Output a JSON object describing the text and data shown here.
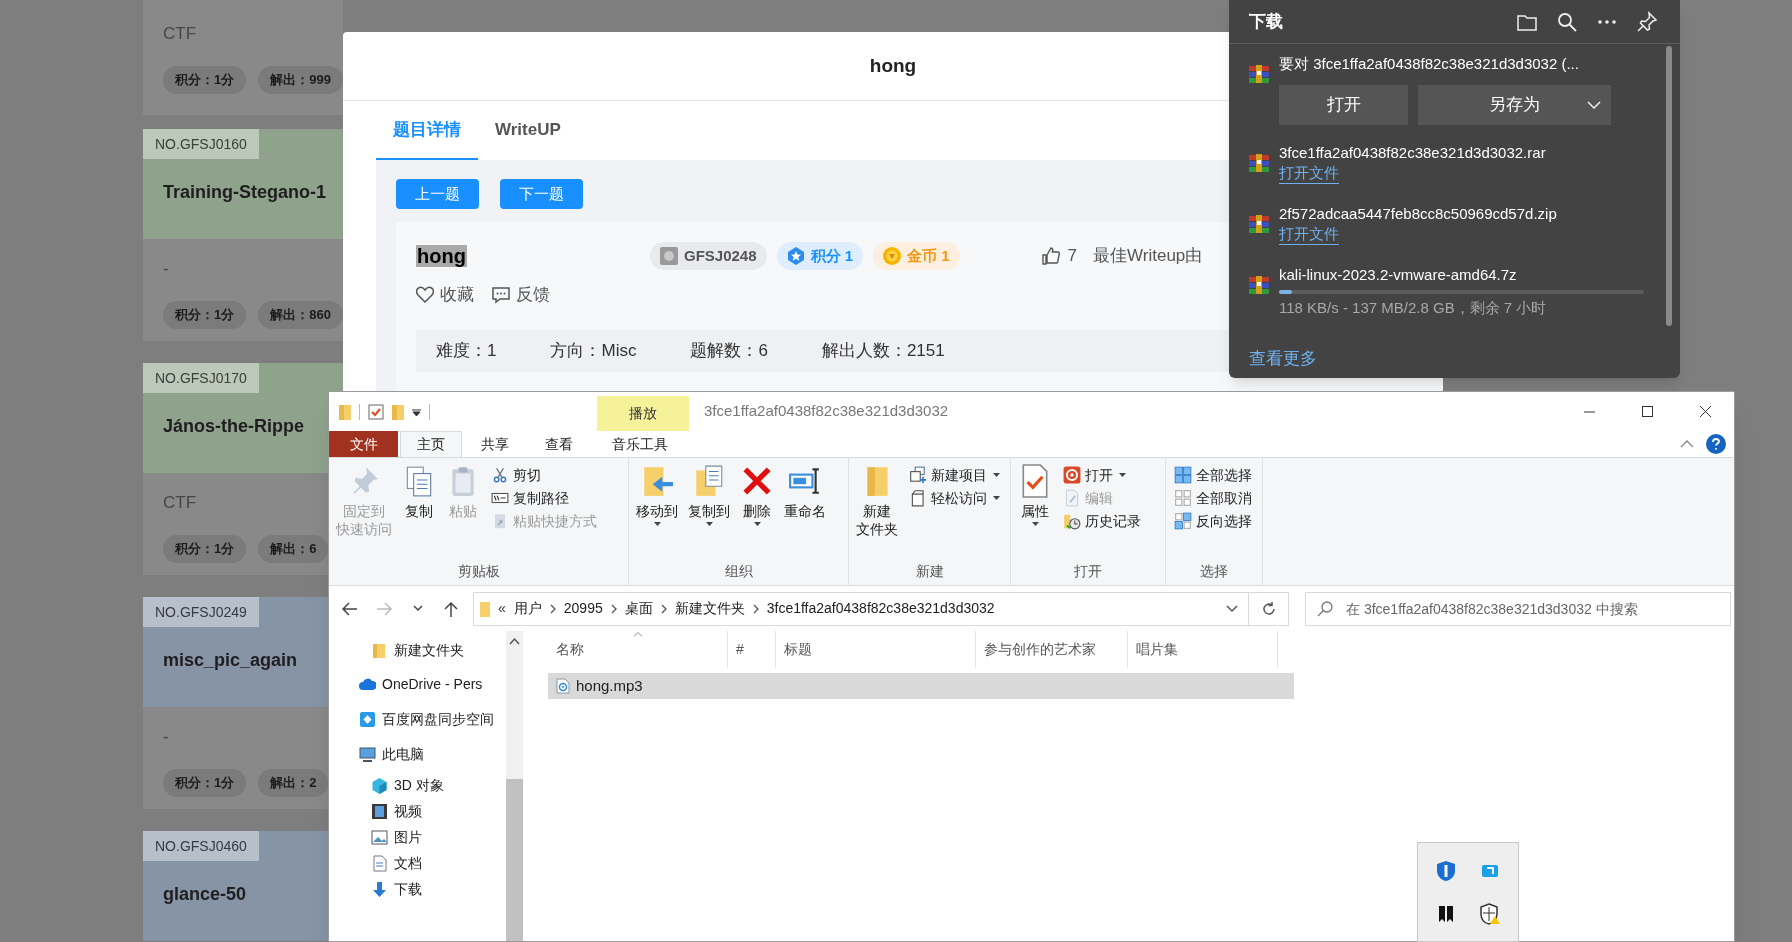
{
  "background_page": {
    "cards": [
      {
        "category": "CTF",
        "tags": [
          "积分：1分",
          "解出：999"
        ]
      },
      {
        "number": "NO.GFSJ0160",
        "color": "#8fa38c",
        "title": "Training-Stegano-1",
        "category": "-",
        "tags": [
          "积分：1分",
          "解出：860"
        ]
      },
      {
        "number": "NO.GFSJ0170",
        "color": "#8fa38c",
        "title": "János-the-Rippe",
        "category": "CTF",
        "tags": [
          "积分：1分",
          "解出：6"
        ]
      },
      {
        "number": "NO.GFSJ0249",
        "color": "#8794a6",
        "title": "misc_pic_again",
        "category": "-",
        "tags": [
          "积分：1分",
          "解出：2"
        ]
      },
      {
        "number": "NO.GFSJ0460",
        "color": "#8794a6",
        "title": "glance-50"
      }
    ]
  },
  "modal": {
    "title": "hong",
    "tabs": [
      {
        "label": "题目详情",
        "selected": true
      },
      {
        "label": "WriteUP",
        "selected": false
      }
    ],
    "nav_buttons": [
      "上一题",
      "下一题"
    ],
    "challenge": {
      "name": "hong",
      "badges": [
        {
          "kind": "id",
          "text": "GFSJ0248"
        },
        {
          "kind": "score",
          "text": "积分 1"
        },
        {
          "kind": "coin",
          "text": "金币 1"
        }
      ],
      "likes": "7",
      "best_writeup": "最佳Writeup由",
      "actions": [
        {
          "kind": "favorite",
          "label": "收藏"
        },
        {
          "kind": "feedback",
          "label": "反馈"
        }
      ],
      "stats": [
        "难度：1",
        "方向：Misc",
        "题解数：6",
        "解出人数：2151"
      ]
    }
  },
  "downloads_panel": {
    "title": "下载",
    "items": [
      {
        "kind": "prompt",
        "text": "要对 3fce1ffa2af0438f82c38e321d3d3032 (...",
        "buttons": [
          "打开",
          "另存为"
        ]
      },
      {
        "kind": "done",
        "name": "3fce1ffa2af0438f82c38e321d3d3032.rar",
        "link": "打开文件"
      },
      {
        "kind": "done",
        "name": "2f572adcaa5447feb8cc8c50969cd57d.zip",
        "link": "打开文件"
      },
      {
        "kind": "progress",
        "name": "kali-linux-2023.2-vmware-amd64.7z",
        "level": 0.035,
        "status": "118 KB/s - 137 MB/2.8 GB，剩余 7 小时"
      }
    ],
    "more_link": "查看更多"
  },
  "explorer": {
    "title": "3fce1ffa2af0438f82c38e321d3d3032",
    "context_tab": "播放",
    "ribbon_tabs": [
      {
        "label": "文件",
        "kind": "file",
        "selected": false
      },
      {
        "label": "主页",
        "kind": "tab",
        "selected": true
      },
      {
        "label": "共享",
        "kind": "tab",
        "selected": false
      },
      {
        "label": "查看",
        "kind": "tab",
        "selected": false
      },
      {
        "label": "音乐工具",
        "kind": "tab",
        "selected": false
      }
    ],
    "ribbon_groups": [
      {
        "label": "剪贴板",
        "buttons": [
          {
            "kind": "pin",
            "lines": [
              "固定到",
              "快速访问"
            ],
            "disabled": true,
            "dropdown": false
          },
          {
            "kind": "copy",
            "lines": [
              "复制"
            ],
            "disabled": false,
            "dropdown": false
          },
          {
            "kind": "paste",
            "lines": [
              "粘贴"
            ],
            "disabled": true,
            "dropdown": false
          }
        ],
        "small_buttons": [
          {
            "kind": "cut",
            "label": "剪切",
            "disabled": false,
            "dropdown": false
          },
          {
            "kind": "copy-path",
            "label": "复制路径",
            "disabled": false,
            "dropdown": false
          },
          {
            "kind": "paste-shortcut",
            "label": "粘贴快捷方式",
            "disabled": true,
            "dropdown": false
          }
        ]
      },
      {
        "label": "组织",
        "buttons": [
          {
            "kind": "move",
            "lines": [
              "移动到"
            ],
            "disabled": false,
            "dropdown": true
          },
          {
            "kind": "copy-to",
            "lines": [
              "复制到"
            ],
            "disabled": false,
            "dropdown": true
          },
          {
            "kind": "delete",
            "lines": [
              "删除"
            ],
            "disabled": false,
            "dropdown": true
          },
          {
            "kind": "rename",
            "lines": [
              "重命名"
            ],
            "disabled": false,
            "dropdown": false
          }
        ]
      },
      {
        "label": "新建",
        "buttons": [
          {
            "kind": "new-folder",
            "lines": [
              "新建",
              "文件夹"
            ],
            "disabled": false,
            "dropdown": false
          }
        ],
        "small_buttons": [
          {
            "kind": "new-item",
            "label": "新建项目",
            "disabled": false,
            "dropdown": true
          },
          {
            "kind": "easy-access",
            "label": "轻松访问",
            "disabled": false,
            "dropdown": true
          }
        ]
      },
      {
        "label": "打开",
        "buttons": [
          {
            "kind": "properties",
            "lines": [
              "属性"
            ],
            "disabled": false,
            "dropdown": true
          }
        ],
        "small_buttons": [
          {
            "kind": "open",
            "label": "打开",
            "disabled": false,
            "dropdown": true
          },
          {
            "kind": "edit",
            "label": "编辑",
            "disabled": true,
            "dropdown": false
          },
          {
            "kind": "history",
            "label": "历史记录",
            "disabled": false,
            "dropdown": false
          }
        ]
      },
      {
        "label": "选择",
        "small_buttons": [
          {
            "kind": "select-all",
            "label": "全部选择",
            "disabled": false,
            "dropdown": false
          },
          {
            "kind": "select-none",
            "label": "全部取消",
            "disabled": false,
            "dropdown": false
          },
          {
            "kind": "invert",
            "label": "反向选择",
            "disabled": false,
            "dropdown": false
          }
        ]
      }
    ],
    "address": {
      "overflow": "«",
      "path": [
        "用户",
        "20995",
        "桌面",
        "新建文件夹",
        "3fce1ffa2af0438f82c38e321d3d3032"
      ]
    },
    "search": {
      "placeholder": "在 3fce1ffa2af0438f82c38e321d3d3032 中搜索"
    },
    "nav_pane": [
      {
        "kind": "folder",
        "label": "新建文件夹"
      },
      {
        "kind": "cloud",
        "label": "OneDrive - Pers"
      },
      {
        "kind": "sync",
        "label": "百度网盘同步空间"
      },
      {
        "kind": "pc",
        "label": "此电脑",
        "children": [
          {
            "kind": "cube",
            "label": "3D 对象"
          },
          {
            "kind": "video",
            "label": "视频"
          },
          {
            "kind": "pictures",
            "label": "图片"
          },
          {
            "kind": "docs",
            "label": "文档"
          },
          {
            "kind": "downloads",
            "label": "下载"
          }
        ]
      }
    ],
    "columns": [
      {
        "label": "名称",
        "sorted": true
      },
      {
        "label": "#",
        "sorted": false
      },
      {
        "label": "标题",
        "sorted": false
      },
      {
        "label": "参与创作的艺术家",
        "sorted": false
      },
      {
        "label": "唱片集",
        "sorted": false
      }
    ],
    "files": [
      {
        "name": "hong.mp3",
        "selected": true
      }
    ]
  }
}
